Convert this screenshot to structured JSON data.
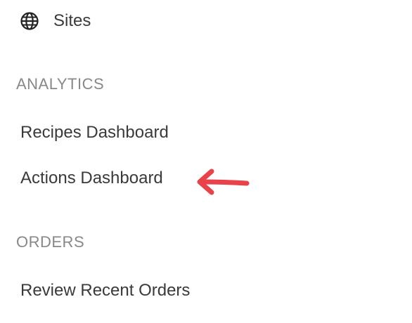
{
  "sidebar": {
    "top_item": {
      "label": "Sites",
      "icon": "globe-icon"
    },
    "sections": [
      {
        "heading": "ANALYTICS",
        "items": [
          {
            "label": "Recipes Dashboard"
          },
          {
            "label": "Actions Dashboard"
          }
        ]
      },
      {
        "heading": "ORDERS",
        "items": [
          {
            "label": "Review Recent Orders"
          }
        ]
      }
    ]
  },
  "annotation": {
    "type": "arrow",
    "color": "#e8434b",
    "points_to": "Actions Dashboard"
  }
}
